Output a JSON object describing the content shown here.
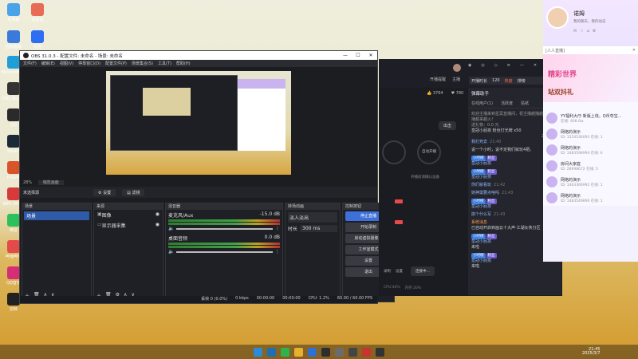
{
  "desktop": {
    "icons": [
      {
        "label": "此电脑",
        "color": "#4aa3e8"
      },
      {
        "label": "回收站",
        "color": "#e86c55"
      },
      {
        "label": "控制面板",
        "color": "#3b7ad9"
      },
      {
        "label": "夸克",
        "color": "#2d6ff2"
      },
      {
        "label": "Microsoft Edge",
        "color": "#1e9fd8"
      },
      {
        "label": "OBS Studio",
        "color": "#333333"
      },
      {
        "label": "QQ",
        "color": "#2a2a2a"
      },
      {
        "label": "Steam",
        "color": "#1b2838"
      },
      {
        "label": "PS&PE",
        "color": "#d9542b"
      },
      {
        "label": "WPS Office",
        "color": "#d63a3a"
      },
      {
        "label": "微信",
        "color": "#2cc15d"
      },
      {
        "label": "哔哩哔哩",
        "color": "#e34a4a"
      },
      {
        "label": "QQ音乐",
        "color": "#d62d77"
      },
      {
        "label": "剪映",
        "color": "#222222"
      }
    ]
  },
  "obs": {
    "title": "OBS 31.0.3 - 配置文件: 未命名 - 场景: 未命名",
    "menu": [
      "文件(F)",
      "编辑(E)",
      "视图(V)",
      "停靠窗口(D)",
      "配置文件(P)",
      "场景集合(S)",
      "工具(T)",
      "帮助(H)"
    ],
    "zoom": "28%",
    "preview_mode": "缩放画面",
    "no_source": "未选择源",
    "properties_btn": "设置",
    "filters_btn": "滤镜",
    "docks": {
      "scenes": {
        "title": "场景",
        "items": [
          "场景"
        ]
      },
      "sources": {
        "title": "来源",
        "items": [
          "图像",
          "显示器采集"
        ]
      },
      "mixer": {
        "title": "混音器",
        "channels": [
          {
            "name": "麦克风/Aux",
            "db": "-15.0 dB"
          },
          {
            "name": "桌面音频",
            "db": "0.0 dB"
          }
        ]
      },
      "transitions": {
        "title": "转场动画",
        "type": "淡入淡出",
        "duration_label": "时长",
        "duration": "300 ms"
      },
      "controls": {
        "title": "控制按钮",
        "buttons": [
          "停止直播",
          "开始录制",
          "启动虚拟摄像机",
          "工作室模式",
          "设置",
          "退出"
        ]
      }
    },
    "status": {
      "dropped": "丢帧 0 (0.0%)",
      "kbps": "0 kbps",
      "time1": "00:00:00",
      "time2": "00:00:00",
      "cpu": "CPU: 1.2%",
      "fps": "60.00 / 60.00 FPS"
    }
  },
  "live": {
    "top_labels": [
      "开播提醒",
      "主播"
    ],
    "stats": {
      "likes": "3764",
      "fans": "780"
    },
    "tabs_row": {
      "level": "开播时长",
      "count": "120",
      "hot": "热度",
      "rank": "排榜"
    },
    "panel_title": "弹幕助手",
    "subtabs": [
      "在线用户(1)",
      "活跃度",
      "贴纸"
    ],
    "notice": "欢迎主播来到星冥直播间，祝主播越播越好，直播越来越火！",
    "gift_line": "送礼物：0.0 元",
    "user_line": "皇冠小屁孩  粉丝灯光牌  x50",
    "left_center": "出击",
    "right_center": "自动开播",
    "sub_text": "开播前请确认设备",
    "connect_btn": "连接中...",
    "small_labels": [
      "录制",
      "设置",
      "CPU:40%",
      "内存:20%"
    ],
    "chat_header": "21条/1人",
    "chats": [
      {
        "user": "我打死去",
        "text": "",
        "time": "21:40"
      },
      {
        "user": "",
        "text": "说一个小时，说不定我们就玩4把。",
        "time": ""
      },
      {
        "user": "皇冠小屁孩",
        "text": "",
        "time": ""
      },
      {
        "user": "皇冠小屁孩",
        "text": "",
        "time": ""
      },
      {
        "user": "你们就看玩",
        "text": "",
        "time": "21:42"
      },
      {
        "user": "她神需要点啥吗",
        "text": "",
        "time": "21:43"
      },
      {
        "user": "皇冠小屁孩",
        "text": "",
        "time": ""
      },
      {
        "user": "搞个什么写",
        "text": "",
        "time": "21:43"
      },
      {
        "user": "系统消息",
        "text": "已自动开启到画云十大声·江湖女侠分区",
        "time": ""
      },
      {
        "user": "皇冠小屁孩",
        "text": "来啦",
        "time": ""
      },
      {
        "user": "皇冠小屁孩",
        "text": "来啦",
        "time": ""
      }
    ],
    "badges": [
      "小时榜",
      "粉丝"
    ]
  },
  "qq": {
    "name": "诺姆",
    "status": "我的聊天，我的动态",
    "title": "[人人直播]",
    "banner1": "精彩世界",
    "banner2": "站双抖礼",
    "items": [
      {
        "name": "YY福利大厅·新版上线，Q币夺宝...",
        "sub": "在线: 408.6w"
      },
      {
        "name": "网络的演示",
        "sub": "ID: 1554536093  在线: 1"
      },
      {
        "name": "网络的演示",
        "sub": "ID: 1483598994  在线: 6"
      },
      {
        "name": "房间大家庭",
        "sub": "ID: 28998672  在线: 5"
      },
      {
        "name": "网络的演示",
        "sub": "ID: 1463366992  在线: 1"
      },
      {
        "name": "网络的演示",
        "sub": "ID: 1483549890  在线: 1"
      }
    ]
  },
  "taskbar": {
    "apps": [
      "#2a8bd6",
      "#1f6fb0",
      "#2fb34a",
      "#e8b02f",
      "#3070d0",
      "#2d2d2d",
      "#6c6c6c",
      "#444444",
      "#c8342f",
      "#333333"
    ],
    "time": "21:45",
    "date": "2025/3/7"
  }
}
